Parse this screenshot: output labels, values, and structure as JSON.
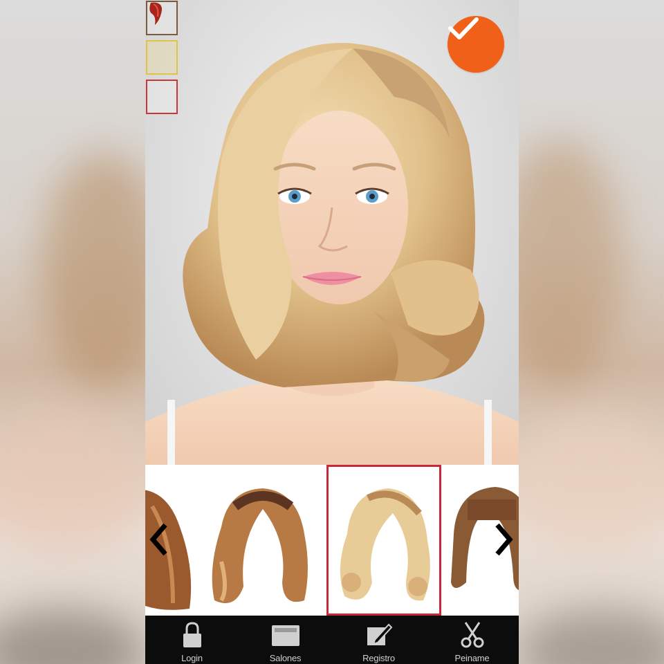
{
  "colors": {
    "accent": "#f06018",
    "selection": "#c8283c",
    "tabbar_bg": "#0c0c0c",
    "tab_text": "#cfcfcf"
  },
  "color_swatches": [
    {
      "name": "brown",
      "icon": "hair-swatch-brown-icon"
    },
    {
      "name": "blonde",
      "icon": "hair-swatch-blonde-icon"
    },
    {
      "name": "red",
      "icon": "hair-swatch-red-icon"
    }
  ],
  "confirm": {
    "icon": "checkmark-icon"
  },
  "carousel": {
    "prev_icon": "chevron-left-icon",
    "next_icon": "chevron-right-icon",
    "selected_index": 2
  },
  "tabbar": {
    "items": [
      {
        "label": "Login",
        "icon": "lock-icon"
      },
      {
        "label": "Salones",
        "icon": "folder-icon"
      },
      {
        "label": "Registro",
        "icon": "edit-icon"
      },
      {
        "label": "Peiname",
        "icon": "scissors-icon"
      }
    ]
  }
}
